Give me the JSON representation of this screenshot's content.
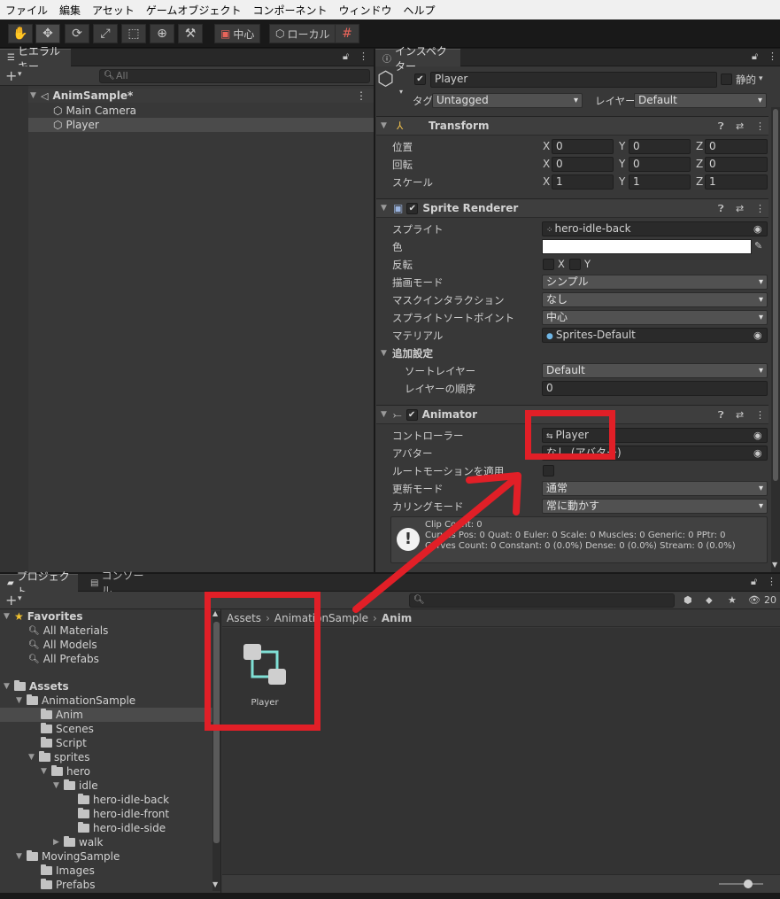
{
  "menu": [
    "ファイル",
    "編集",
    "アセット",
    "ゲームオブジェクト",
    "コンポーネント",
    "ウィンドウ",
    "ヘルプ"
  ],
  "toolbar": {
    "pivot_label": "中心",
    "space_label": "ローカル",
    "tools": [
      "hand-icon",
      "move-icon",
      "rotate-icon",
      "scale-icon",
      "rect-icon",
      "transform-icon",
      "custom-tool-icon"
    ]
  },
  "hierarchy": {
    "tab": "ヒエラルキー",
    "search_placeholder": "All",
    "scene": "AnimSample*",
    "items": [
      "Main Camera",
      "Player"
    ]
  },
  "inspector": {
    "tab": "インスペクター",
    "object_name": "Player",
    "static_label": "静的",
    "tag_label": "タグ",
    "tag_value": "Untagged",
    "layer_label": "レイヤー",
    "layer_value": "Default",
    "transform": {
      "title": "Transform",
      "position_label": "位置",
      "rotation_label": "回転",
      "scale_label": "スケール",
      "axis_x": "X",
      "axis_y": "Y",
      "axis_z": "Z",
      "position": [
        "0",
        "0",
        "0"
      ],
      "rotation": [
        "0",
        "0",
        "0"
      ],
      "scale": [
        "1",
        "1",
        "1"
      ]
    },
    "sprite_renderer": {
      "title": "Sprite Renderer",
      "sprite_label": "スプライト",
      "sprite_value": "hero-idle-back",
      "color_label": "色",
      "flip_label": "反転",
      "flip_x": "X",
      "flip_y": "Y",
      "draw_mode_label": "描画モード",
      "draw_mode_value": "シンプル",
      "mask_label": "マスクインタラクション",
      "mask_value": "なし",
      "sort_point_label": "スプライトソートポイント",
      "sort_point_value": "中心",
      "material_label": "マテリアル",
      "material_value": "Sprites-Default",
      "additional_label": "追加設定",
      "sorting_layer_label": "ソートレイヤー",
      "sorting_layer_value": "Default",
      "order_label": "レイヤーの順序",
      "order_value": "0"
    },
    "animator": {
      "title": "Animator",
      "controller_label": "コントローラー",
      "controller_value": "Player",
      "avatar_label": "アバター",
      "avatar_value": "なし (アバター)",
      "root_motion_label": "ルートモーションを適用",
      "update_label": "更新モード",
      "update_value": "通常",
      "culling_label": "カリングモード",
      "culling_value": "常に動かす",
      "info_line1": "Clip Count: 0",
      "info_line2": "Curves Pos: 0 Quat: 0 Euler: 0 Scale: 0 Muscles: 0 Generic: 0 PPtr: 0",
      "info_line3": "Curves Count: 0 Constant: 0 (0.0%) Dense: 0 (0.0%) Stream: 0 (0.0%)"
    }
  },
  "project": {
    "tab_project": "プロジェクト",
    "tab_console": "コンソール",
    "visible_count": "20",
    "favorites": {
      "title": "Favorites",
      "items": [
        "All Materials",
        "All Models",
        "All Prefabs"
      ]
    },
    "assets_title": "Assets",
    "tree": [
      {
        "label": "AnimationSample",
        "depth": 1,
        "open": true
      },
      {
        "label": "Anim",
        "depth": 2,
        "open": false
      },
      {
        "label": "Scenes",
        "depth": 2,
        "open": false
      },
      {
        "label": "Script",
        "depth": 2,
        "open": false
      },
      {
        "label": "sprites",
        "depth": 2,
        "open": true
      },
      {
        "label": "hero",
        "depth": 3,
        "open": true
      },
      {
        "label": "idle",
        "depth": 4,
        "open": true
      },
      {
        "label": "hero-idle-back",
        "depth": 5,
        "open": false
      },
      {
        "label": "hero-idle-front",
        "depth": 5,
        "open": false
      },
      {
        "label": "hero-idle-side",
        "depth": 5,
        "open": false
      },
      {
        "label": "walk",
        "depth": 4,
        "open": false
      },
      {
        "label": "MovingSample",
        "depth": 1,
        "open": true
      },
      {
        "label": "Images",
        "depth": 2,
        "open": false
      },
      {
        "label": "Prefabs",
        "depth": 2,
        "open": false
      }
    ],
    "breadcrumb": [
      "Assets",
      "AnimationSample",
      "Anim"
    ],
    "asset_name": "Player"
  },
  "colors": {
    "annotation": "#e11f27",
    "controller_icon": "#7fe0d6"
  }
}
